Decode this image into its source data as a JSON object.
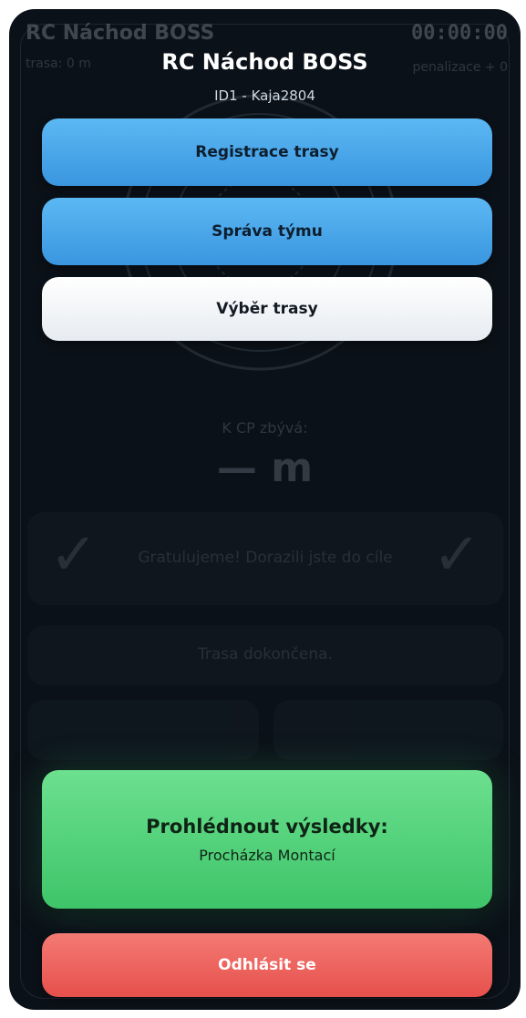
{
  "background": {
    "title": "RC Náchod BOSS",
    "timer": "00:00:00",
    "trasa": "trasa: 0 m",
    "penalizace": "penalizace + 0",
    "k_cp_label": "K CP zbývá:",
    "distance": "— m",
    "finish_message": "Gratulujeme! Dorazili jste do cíle",
    "route_done": "Trasa dokončena."
  },
  "menu": {
    "title": "RC Náchod BOSS",
    "user": "ID1 - Kaja2804",
    "buttons": {
      "registrace": "Registrace trasy",
      "sprava": "Správa týmu",
      "vyber": "Výběr trasy",
      "vysledky_title": "Prohlédnout výsledky:",
      "vysledky_name": "Procházka Montací",
      "odhlasit": "Odhlásit se"
    }
  },
  "colors": {
    "blue": "#4aa7ea",
    "green": "#4fcf78",
    "red": "#ec605b",
    "white": "#f3f5f8",
    "overlay": "#0b1118"
  }
}
